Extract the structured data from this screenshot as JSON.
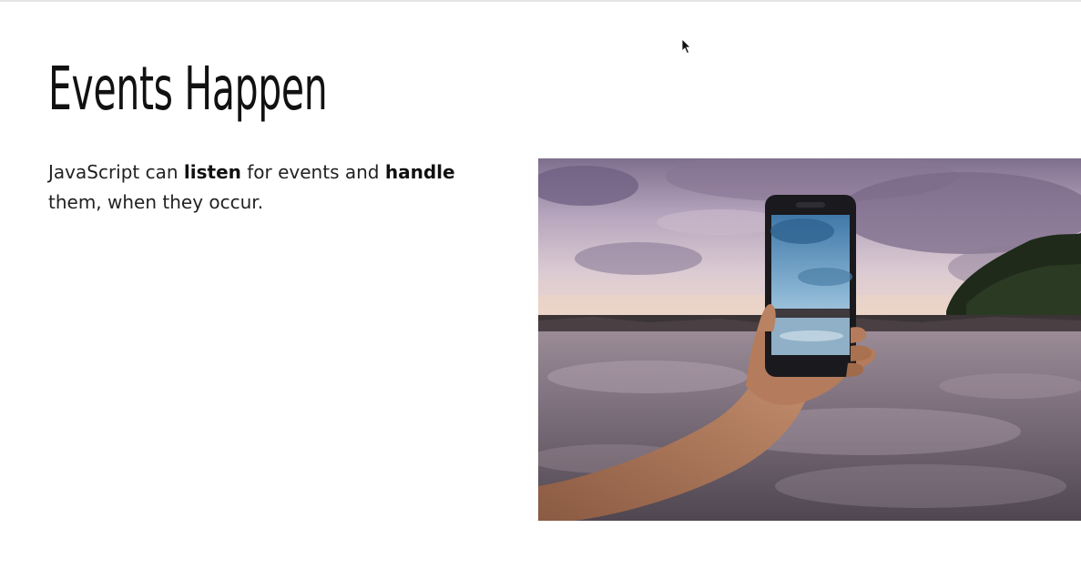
{
  "slide": {
    "title": "Events Happen",
    "body": {
      "part1": "JavaScript can ",
      "bold1": "listen",
      "part2": " for events and ",
      "bold2": "handle",
      "part3": " them, when they occur."
    }
  },
  "photo": {
    "subject": "hand-holding-phone-photographing-beach-photo",
    "colors": {
      "sky_top": "#8e7f9a",
      "sky_mid": "#cdbfcf",
      "horizon": "#e8d3c8",
      "water": "#6f6470",
      "island": "#1f2a1a",
      "skin": "#b27a5c",
      "phone": "#1a1a1e",
      "screen_sky": "#4f87b4"
    }
  },
  "cursor": {
    "icon": "mouse-pointer-icon"
  }
}
